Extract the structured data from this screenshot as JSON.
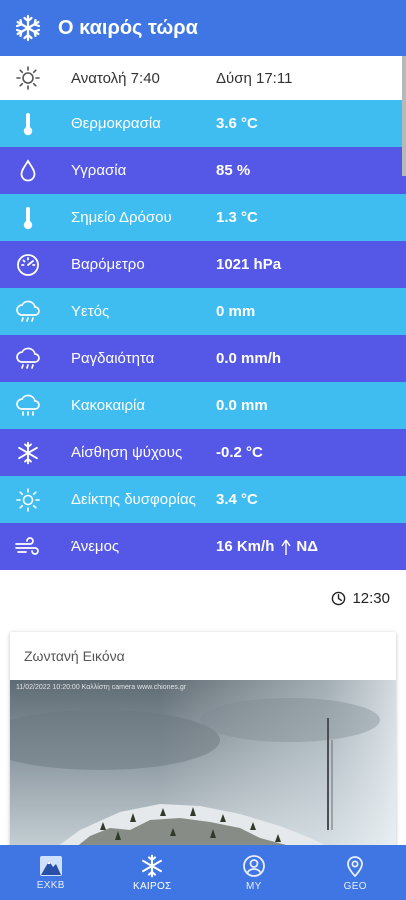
{
  "appbar": {
    "title": "Ο καιρός τώρα",
    "icon": "snowflake-icon"
  },
  "rows": [
    {
      "icon": "sun-icon",
      "label": "Ανατολή 7:40",
      "value": "Δύση 17:11"
    },
    {
      "icon": "thermometer-icon",
      "label": "Θερμοκρασία",
      "value": "3.6 °C"
    },
    {
      "icon": "droplet-icon",
      "label": "Υγρασία",
      "value": "85 %"
    },
    {
      "icon": "thermometer-icon",
      "label": "Σημείο Δρόσου",
      "value": "1.3 °C"
    },
    {
      "icon": "gauge-icon",
      "label": "Βαρόμετρο",
      "value": "1021 hPa"
    },
    {
      "icon": "rain-cloud-icon",
      "label": "Υετός",
      "value": "0 mm"
    },
    {
      "icon": "rain-cloud-icon",
      "label": "Ραγδαιότητα",
      "value": "0.0 mm/h"
    },
    {
      "icon": "storm-cloud-icon",
      "label": "Κακοκαιρία",
      "value": "0.0 mm"
    },
    {
      "icon": "snowflake-icon",
      "label": "Αίσθηση ψύχους",
      "value": "-0.2 °C"
    },
    {
      "icon": "sun-icon",
      "label": "Δείκτης δυσφορίας",
      "value": "3.4 °C"
    },
    {
      "icon": "wind-icon",
      "label": "Άνεμος",
      "value": "16 Km/h",
      "direction": "ΝΔ"
    }
  ],
  "updated": {
    "time": "12:30",
    "icon": "clock-icon"
  },
  "live_image": {
    "title": "Ζωντανή Εικόνα",
    "stamp": "11/02/2022 10:20:00 Καλλίστη camera   www.chiones.gr"
  },
  "bottom_nav": [
    {
      "label": "ΕΧΚΒ",
      "icon": "mountain-icon"
    },
    {
      "label": "ΚΑΙΡΟΣ",
      "icon": "snowflake-icon",
      "active": true
    },
    {
      "label": "MY",
      "icon": "user-icon"
    },
    {
      "label": "GEO",
      "icon": "location-pin-icon"
    }
  ],
  "colors": {
    "appbar": "#3f76e4",
    "row_light": "#3fbdf0",
    "row_dark": "#5558e6"
  }
}
